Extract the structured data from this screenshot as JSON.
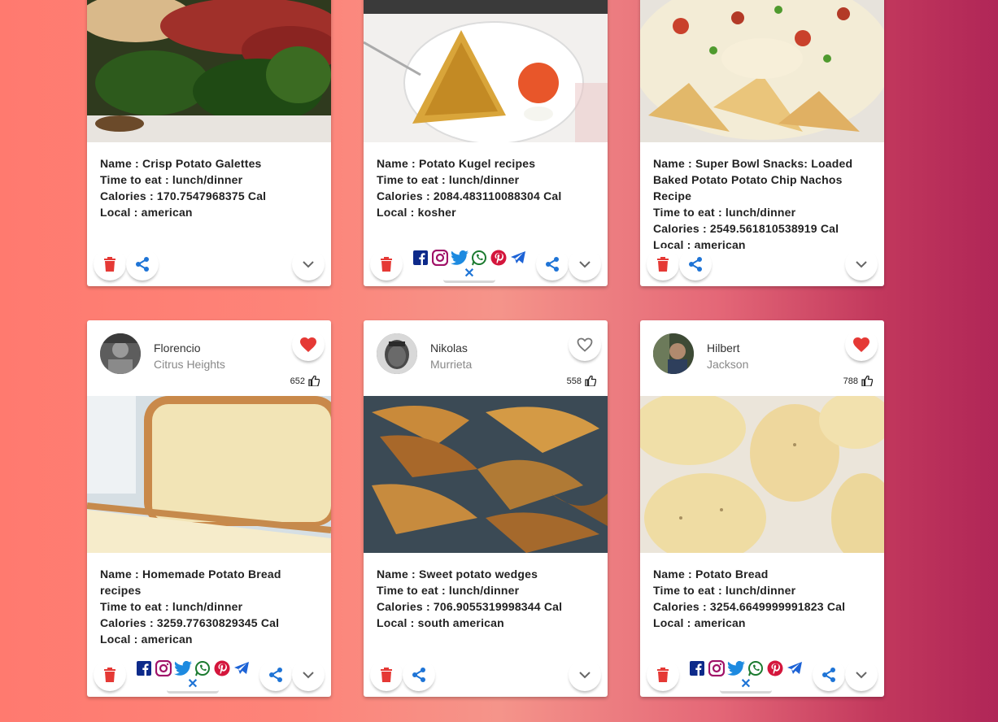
{
  "colors": {
    "delete": "#e53935",
    "share": "#1e74d6",
    "heart_on": "#e53935",
    "heart_off": "#777777"
  },
  "cards": [
    {
      "info": {
        "name": "Name : Crisp Potato Galettes",
        "time": "Time to eat : lunch/dinner",
        "calories": "Calories : 170.7547968375 Cal",
        "local": "Local : american"
      }
    },
    {
      "info": {
        "name": "Name : Potato Kugel recipes",
        "time": "Time to eat : lunch/dinner",
        "calories": "Calories : 2084.483110088304 Cal",
        "local": "Local : kosher"
      }
    },
    {
      "info": {
        "name": "Name : Super Bowl Snacks: Loaded Baked Potato Potato Chip Nachos Recipe",
        "time": "Time to eat : lunch/dinner",
        "calories": "Calories : 2549.561810538919 Cal",
        "local": "Local : american"
      }
    },
    {
      "user": {
        "name": "Florencio",
        "location": "Citrus Heights",
        "likes": "652",
        "liked": true
      },
      "info": {
        "name": "Name : Homemade Potato Bread recipes",
        "time": "Time to eat : lunch/dinner",
        "calories": "Calories : 3259.77630829345 Cal",
        "local": "Local : american"
      }
    },
    {
      "user": {
        "name": "Nikolas",
        "location": "Murrieta",
        "likes": "558",
        "liked": false
      },
      "info": {
        "name": "Name : Sweet potato wedges",
        "time": "Time to eat : lunch/dinner",
        "calories": "Calories : 706.9055319998344 Cal",
        "local": "Local : south american"
      }
    },
    {
      "user": {
        "name": "Hilbert",
        "location": "Jackson",
        "likes": "788",
        "liked": true
      },
      "info": {
        "name": "Name : Potato Bread",
        "time": "Time to eat : lunch/dinner",
        "calories": "Calories : 3254.6649999991823 Cal",
        "local": "Local : american"
      }
    }
  ],
  "share_networks": [
    "facebook-icon",
    "instagram-icon",
    "twitter-icon",
    "whatsapp-icon",
    "pinterest-icon",
    "telegram-icon"
  ],
  "close_symbol": "✕"
}
